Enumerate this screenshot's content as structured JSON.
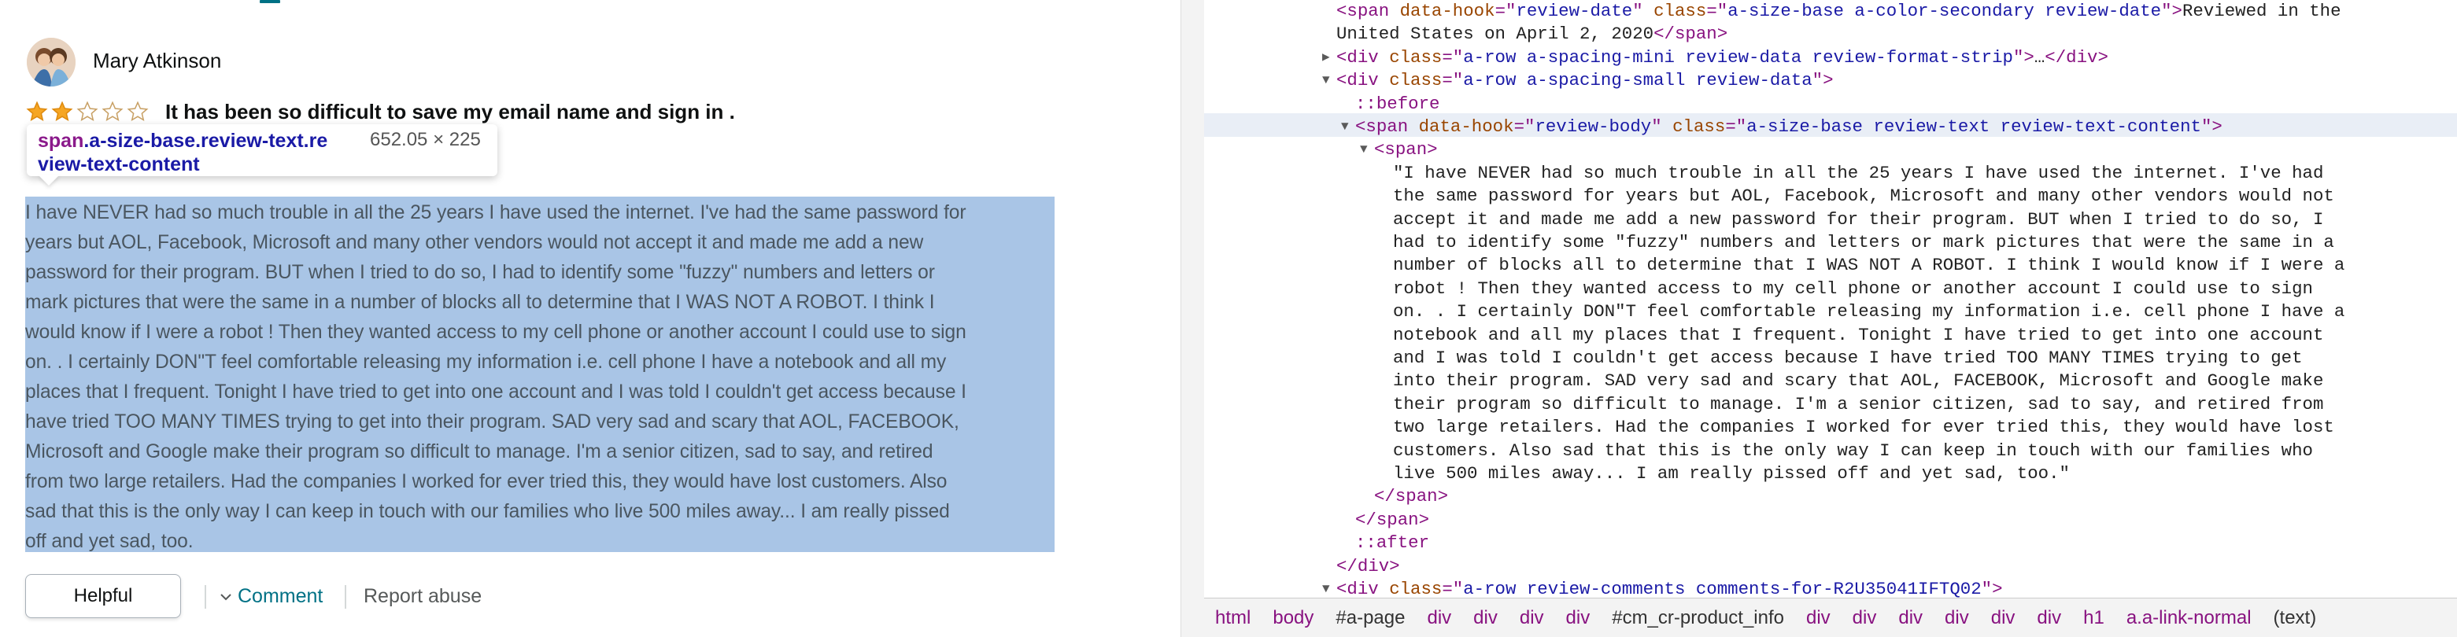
{
  "review": {
    "reviewer_name": "Mary Atkinson",
    "rating": 2,
    "rating_max": 5,
    "title": "It has been so difficult to save my email name and sign in .",
    "body_lines": [
      "I have NEVER had so much trouble in all the 25 years I have used the internet. I've had the same password for",
      "years but AOL, Facebook, Microsoft and many other vendors would not accept it and made me add a new",
      "password for their program. BUT when I tried to do so, I had to identify some \"fuzzy\" numbers and letters or",
      "mark pictures that were the same in a number of blocks all to determine that I WAS NOT A ROBOT. I think I",
      "would know if I were a robot ! Then they wanted access to my cell phone or another account I could use to sign",
      "on. . I certainly DON\"T feel comfortable releasing my information i.e. cell phone I have a notebook and all my",
      "places that I frequent. Tonight I have tried to get into one account and I was told I couldn't get access because I",
      "have tried TOO MANY TIMES trying to get into their program. SAD very sad and scary that AOL, FACEBOOK,",
      "Microsoft and Google make their program so difficult to manage. I'm a senior citizen, sad to say, and retired",
      "from two large retailers. Had the companies I worked for ever tried this, they would have lost customers. Also",
      "sad that this is the only way I can keep in touch with our families who live 500 miles away... I am really pissed",
      "off and yet sad, too."
    ],
    "helpful_label": "Helpful",
    "comment_label": "Comment",
    "report_label": "Report abuse"
  },
  "inspect_tooltip": {
    "selector_tag": "span",
    "selector_class_line1": ".a-size-base.review-text.re",
    "selector_class_line2": "view-text-content",
    "dimensions": "652.05 × 225"
  },
  "devtools": {
    "lines": [
      {
        "indent": 0,
        "parts": [
          [
            "tag",
            "<span "
          ],
          [
            "attr",
            "data-hook"
          ],
          [
            "tag",
            "=\""
          ],
          [
            "val",
            "review-date"
          ],
          [
            "tag",
            "\" "
          ],
          [
            "attr",
            "class"
          ],
          [
            "tag",
            "=\""
          ],
          [
            "val",
            "a-size-base a-color-secondary review-date"
          ],
          [
            "tag",
            "\">"
          ],
          [
            "txt",
            "Reviewed in the"
          ]
        ]
      },
      {
        "indent": 0,
        "parts": [
          [
            "txt",
            "United States on April 2, 2020"
          ],
          [
            "tag",
            "</span>"
          ]
        ]
      },
      {
        "indent": 0,
        "tri": "▶",
        "parts": [
          [
            "tag",
            "<div "
          ],
          [
            "attr",
            "class"
          ],
          [
            "tag",
            "=\""
          ],
          [
            "val",
            "a-row a-spacing-mini review-data review-format-strip"
          ],
          [
            "tag",
            "\">"
          ],
          [
            "txt",
            "…"
          ],
          [
            "tag",
            "</div>"
          ]
        ]
      },
      {
        "indent": 0,
        "tri": "▼",
        "parts": [
          [
            "tag",
            "<div "
          ],
          [
            "attr",
            "class"
          ],
          [
            "tag",
            "=\""
          ],
          [
            "val",
            "a-row a-spacing-small review-data"
          ],
          [
            "tag",
            "\">"
          ]
        ]
      },
      {
        "indent": 1,
        "parts": [
          [
            "pseudo",
            "::before"
          ]
        ]
      },
      {
        "indent": 1,
        "tri": "▼",
        "parts": [
          [
            "tag",
            "<span "
          ],
          [
            "attr",
            "data-hook"
          ],
          [
            "tag",
            "=\""
          ],
          [
            "val",
            "review-body"
          ],
          [
            "tag",
            "\" "
          ],
          [
            "attr",
            "class"
          ],
          [
            "tag",
            "=\""
          ],
          [
            "val",
            "a-size-base review-text review-text-content"
          ],
          [
            "tag",
            "\">"
          ]
        ]
      },
      {
        "indent": 2,
        "tri": "▼",
        "parts": [
          [
            "tag",
            "<span>"
          ]
        ]
      },
      {
        "indent": 3,
        "parts": [
          [
            "txt",
            "\"I have NEVER had so much trouble in all the 25 years I have used the internet. I've had"
          ]
        ]
      },
      {
        "indent": 3,
        "parts": [
          [
            "txt",
            "the same password for years but AOL, Facebook, Microsoft and many other vendors would not"
          ]
        ]
      },
      {
        "indent": 3,
        "parts": [
          [
            "txt",
            "accept it and made me add a new password for their program. BUT when I tried to do so, I"
          ]
        ]
      },
      {
        "indent": 3,
        "parts": [
          [
            "txt",
            "had to identify some \"fuzzy\" numbers and letters or mark pictures that were the same in a"
          ]
        ]
      },
      {
        "indent": 3,
        "parts": [
          [
            "txt",
            "number of blocks all to determine that I WAS NOT A ROBOT. I think I would know if I were a"
          ]
        ]
      },
      {
        "indent": 3,
        "parts": [
          [
            "txt",
            "robot ! Then they wanted access to my cell phone or another account I could use to sign"
          ]
        ]
      },
      {
        "indent": 3,
        "parts": [
          [
            "txt",
            "on. . I certainly DON\"T feel comfortable releasing my information i.e. cell phone I have a"
          ]
        ]
      },
      {
        "indent": 3,
        "parts": [
          [
            "txt",
            "notebook and all my places that I frequent. Tonight I have tried to get into one account"
          ]
        ]
      },
      {
        "indent": 3,
        "parts": [
          [
            "txt",
            "and I was told I couldn't get access because I have tried TOO MANY TIMES trying to get"
          ]
        ]
      },
      {
        "indent": 3,
        "parts": [
          [
            "txt",
            "into their program. SAD very sad and scary that AOL, FACEBOOK, Microsoft and Google make"
          ]
        ]
      },
      {
        "indent": 3,
        "parts": [
          [
            "txt",
            "their program so difficult to manage. I'm a senior citizen, sad to say, and retired from"
          ]
        ]
      },
      {
        "indent": 3,
        "parts": [
          [
            "txt",
            "two large retailers. Had the companies I worked for ever tried this, they would have lost"
          ]
        ]
      },
      {
        "indent": 3,
        "parts": [
          [
            "txt",
            "customers. Also sad that this is the only way I can keep in touch with our families who"
          ]
        ]
      },
      {
        "indent": 3,
        "parts": [
          [
            "txt",
            "live 500 miles away... I am really pissed off and yet sad, too.\""
          ]
        ]
      },
      {
        "indent": 2,
        "parts": [
          [
            "tag",
            "</span>"
          ]
        ]
      },
      {
        "indent": 1,
        "parts": [
          [
            "tag",
            "</span>"
          ]
        ]
      },
      {
        "indent": 1,
        "parts": [
          [
            "pseudo",
            "::after"
          ]
        ]
      },
      {
        "indent": 0,
        "parts": [
          [
            "tag",
            "</div>"
          ]
        ]
      },
      {
        "indent": 0,
        "tri": "▼",
        "parts": [
          [
            "tag",
            "<div "
          ],
          [
            "attr",
            "class"
          ],
          [
            "tag",
            "=\""
          ],
          [
            "val",
            "a-row review-comments comments-for-R2U35041IFTQ02"
          ],
          [
            "tag",
            "\">"
          ]
        ]
      },
      {
        "indent": 1,
        "parts": [
          [
            "pseudo",
            "::before"
          ]
        ]
      }
    ],
    "breadcrumbs": [
      "html",
      "body",
      "#a-page",
      "div",
      "div",
      "div",
      "div",
      "#cm_cr-product_info",
      "div",
      "div",
      "div",
      "div",
      "div",
      "div",
      "h1",
      "a.a-link-normal",
      "(text)"
    ]
  },
  "colors": {
    "highlight": "#a9c5e6",
    "star_fill": "#f6a623",
    "link": "#007185",
    "dt_tag": "#881280",
    "dt_attr": "#994500",
    "dt_val": "#1a1aa6"
  }
}
